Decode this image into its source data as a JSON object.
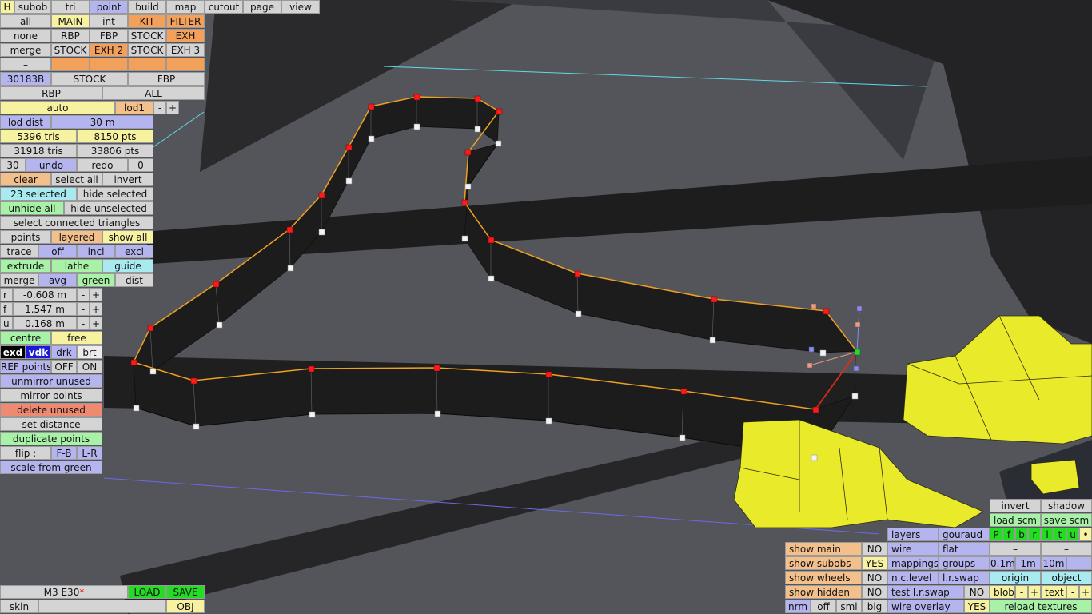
{
  "topbar": {
    "items": [
      {
        "label": "H",
        "c": "ye"
      },
      {
        "label": "subob",
        "c": "lg"
      },
      {
        "label": "tri",
        "c": "lg"
      },
      {
        "label": "point",
        "c": "bl"
      },
      {
        "label": "build",
        "c": "lg"
      },
      {
        "label": "map",
        "c": "lg"
      },
      {
        "label": "cutout",
        "c": "lg"
      },
      {
        "label": "page",
        "c": "lg"
      },
      {
        "label": "view",
        "c": "lg"
      }
    ]
  },
  "subob_panel": {
    "row1": [
      "all",
      "MAIN",
      "int",
      "KIT",
      "FILTER"
    ],
    "row2": [
      "none",
      "RBP",
      "FBP",
      "STOCK",
      "EXH"
    ],
    "row3": [
      "merge",
      "STOCK",
      "EXH 2",
      "STOCK",
      "EXH 3"
    ],
    "row4": [
      "–",
      "",
      "",
      ""
    ],
    "row5": [
      "30183B",
      "STOCK",
      "FBP"
    ],
    "row6": [
      "RBP",
      "ALL"
    ]
  },
  "lod": {
    "auto": "auto",
    "lod": "lod1",
    "minus": "-",
    "plus": "+",
    "dist_label": "lod dist",
    "dist_value": "30 m"
  },
  "stats": {
    "tris": "5396 tris",
    "pts": "8150 pts",
    "tris_total": "31918 tris",
    "pts_total": "33806 pts"
  },
  "history": {
    "count": "30",
    "undo": "undo",
    "redo": "redo",
    "redo_count": "0"
  },
  "selection": {
    "clear": "clear",
    "select_all": "select all",
    "invert": "invert",
    "selected": "23 selected",
    "hide_selected": "hide selected",
    "unhide_all": "unhide all",
    "hide_unselected": "hide unselected",
    "select_connected": "select connected triangles"
  },
  "mode": {
    "points": "points",
    "layered": "layered",
    "show_all": "show all"
  },
  "trace": {
    "label": "trace",
    "off": "off",
    "incl": "incl",
    "excl": "excl"
  },
  "ops": {
    "extrude": "extrude",
    "lathe": "lathe",
    "guide": "guide",
    "merge": "merge",
    "avg": "avg",
    "green": "green",
    "dist": "dist"
  },
  "coords": [
    {
      "axis": "r",
      "value": "-0.608 m"
    },
    {
      "axis": "f",
      "value": "1.547 m"
    },
    {
      "axis": "u",
      "value": "0.168 m"
    }
  ],
  "stepper": {
    "minus": "-",
    "plus": "+"
  },
  "pivot": {
    "centre": "centre",
    "free": "free"
  },
  "shade": {
    "exd": "exd",
    "vdk": "vdk",
    "drk": "drk",
    "brt": "brt"
  },
  "ref": {
    "label": "REF points",
    "off": "OFF",
    "on": "ON"
  },
  "actions": [
    "unmirror unused",
    "mirror points",
    "delete unused",
    "set distance",
    "duplicate points"
  ],
  "flip": {
    "label": "flip :",
    "fb": "F-B",
    "lr": "L-R"
  },
  "scale": "scale from green",
  "bottom_left": {
    "model": "M3 E30",
    "unsaved_mark": "*",
    "load": "LOAD",
    "save": "SAVE",
    "skin": "skin",
    "obj": "OBJ"
  },
  "display": {
    "show_main": "show main",
    "show_main_val": "NO",
    "show_subobs": "show subobs",
    "show_subobs_val": "YES",
    "show_wheels": "show wheels",
    "show_wheels_val": "NO",
    "show_hidden": "show hidden",
    "show_hidden_val": "NO",
    "nrm": "nrm",
    "off": "off",
    "sml": "sml",
    "big": "big",
    "layers": "layers",
    "gouraud": "gouraud",
    "wire": "wire",
    "flat": "flat",
    "mappings": "mappings",
    "groups": "groups",
    "nc_level": "n.c.level",
    "lr_swap": "l.r.swap",
    "test_lr_swap": "test l.r.swap",
    "test_lr_swap_val": "NO",
    "wire_overlay": "wire overlay",
    "wire_overlay_val": "YES",
    "invert": "invert",
    "shadow": "shadow",
    "load_scm": "load scm",
    "save_scm": "save scm",
    "letters": [
      "P",
      "f",
      "b",
      "r",
      "l",
      "t",
      "u",
      "•"
    ],
    "dash1": "–",
    "dash2": "–",
    "grid": [
      "0.1m",
      "1m",
      "10m",
      "–"
    ],
    "origin": "origin",
    "object": "object",
    "blob": "blob",
    "text": "text",
    "minus": "-",
    "plus": "+",
    "reload": "reload textures"
  },
  "colors": {
    "selected_point": "#ff1a1a",
    "unselected_point": "#f4f4f4",
    "active_point": "#22dd22",
    "outline": "#f0a020",
    "mesh": "#1c1c1c",
    "subobject": "#e8ea2a"
  }
}
